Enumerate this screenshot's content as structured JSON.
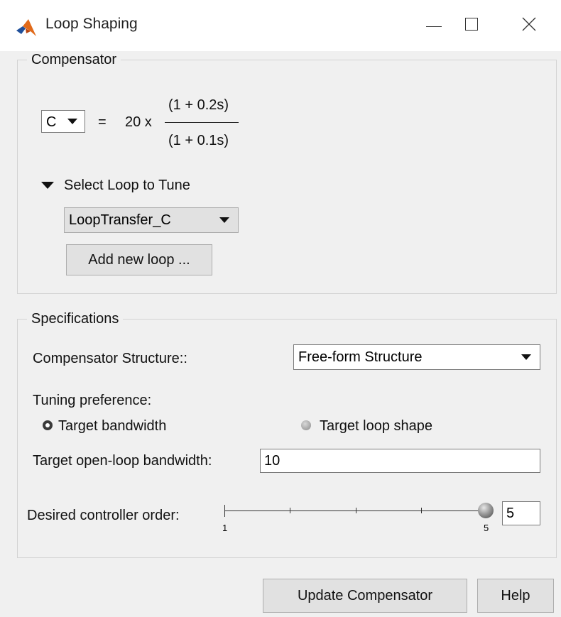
{
  "window": {
    "title": "Loop Shaping",
    "buttons": [
      "minimize",
      "maximize",
      "close"
    ]
  },
  "compensator_panel": {
    "legend": "Compensator",
    "compensator_select": "C",
    "equals": "=",
    "gain": "20 x",
    "numerator": "(1 + 0.2s)",
    "denominator": "(1 + 0.1s)",
    "loop_section_label": "Select Loop to Tune",
    "loop_select": "LoopTransfer_C",
    "add_loop_button": "Add new loop ..."
  },
  "specifications_panel": {
    "legend": "Specifications",
    "structure_label": "Compensator Structure::",
    "structure_select": "Free-form Structure",
    "tuning_label": "Tuning preference:",
    "radio_bandwidth": "Target bandwidth",
    "radio_bandwidth_selected": true,
    "radio_loopshape": "Target loop shape",
    "bandwidth_label": "Target open-loop bandwidth:",
    "bandwidth_value": "10",
    "order_label": "Desired controller order:",
    "slider_min": "1",
    "slider_max": "5",
    "slider_value": 5,
    "order_value": "5"
  },
  "footer": {
    "update_button": "Update Compensator",
    "help_button": "Help"
  },
  "colors": {
    "window_bg": "#f0f0f0",
    "titlebar_bg": "#ffffff",
    "button_bg": "#e1e1e1",
    "matlab_orange": "#e16a1a",
    "matlab_blue": "#1f4f9a"
  },
  "icons": {
    "app": "matlab-logo-icon",
    "dropdown": "triangle-down-icon",
    "section_toggle": "triangle-down-icon"
  }
}
